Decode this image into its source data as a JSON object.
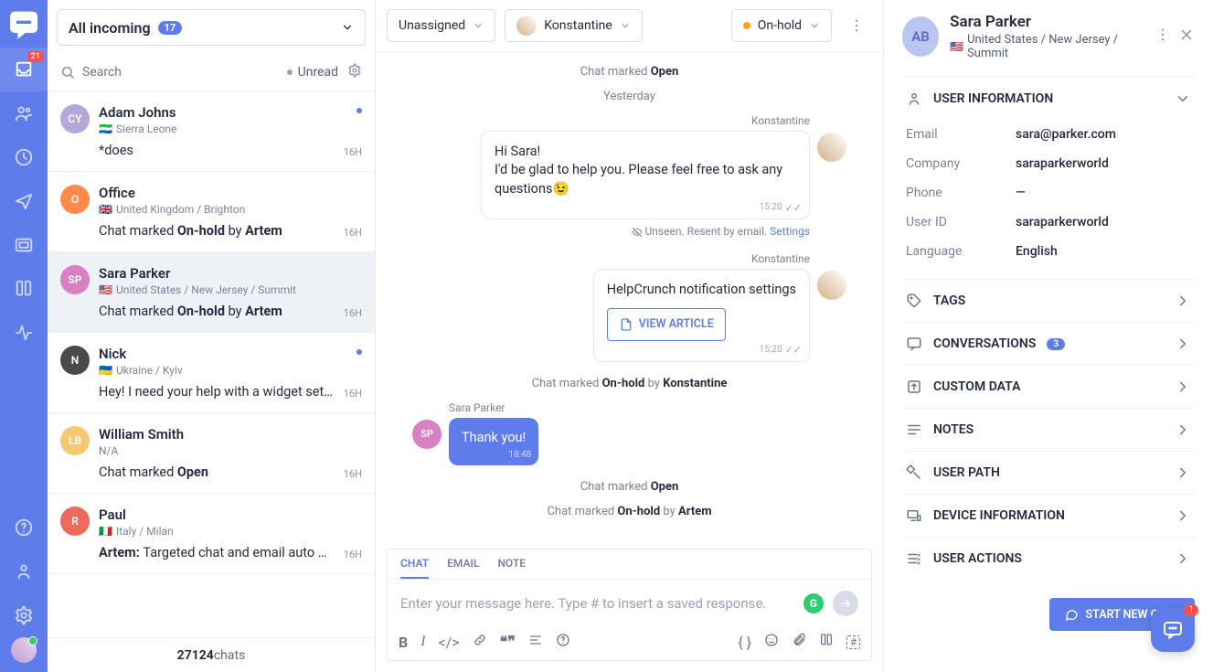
{
  "rail": {
    "inbox_badge": "21"
  },
  "filter": {
    "label": "All incoming",
    "count": "17"
  },
  "search": {
    "placeholder": "Search",
    "unread": "Unread"
  },
  "conversations": [
    {
      "initials": "CY",
      "name": "Adam Johns",
      "flag": "🇸🇱",
      "sub": "Sierra Leone",
      "msg": "*does",
      "time": "16H",
      "new": true,
      "avcls": "av-cy"
    },
    {
      "initials": "O",
      "name": "Office",
      "flag": "🇬🇧",
      "sub": "United Kingdom / Brighton",
      "msg_prefix": "Chat marked ",
      "msg_bold": "On-hold",
      "msg_by": " by ",
      "msg_who": "Artem",
      "time": "16H",
      "avcls": "av-o"
    },
    {
      "initials": "SP",
      "name": "Sara Parker",
      "flag": "🇺🇸",
      "sub": "United States / New Jersey / Summit",
      "msg_prefix": "Chat marked ",
      "msg_bold": "On-hold",
      "msg_by": " by ",
      "msg_who": "Artem",
      "time": "16H",
      "selected": true,
      "avcls": "av-sp"
    },
    {
      "initials": "N",
      "name": "Nick",
      "flag": "🇺🇦",
      "sub": "Ukraine / Kyiv",
      "msg": "Hey! I need your help with a widget set …",
      "time": "16H",
      "new": true,
      "avcls": "av-n"
    },
    {
      "initials": "LB",
      "name": "William Smith",
      "sub": "N/A",
      "msg_prefix": "Chat marked ",
      "msg_bold": "Open",
      "time": "16H",
      "avcls": "av-lb"
    },
    {
      "initials": "R",
      "name": "Paul",
      "flag": "🇮🇹",
      "sub": "Italy / Milan",
      "msg_who2": "Artem: ",
      "msg": "Targeted chat and email auto …",
      "time": "16H",
      "avcls": "av-r"
    }
  ],
  "footer": {
    "count": "27124",
    "label": " chats"
  },
  "header": {
    "assign": "Unassigned",
    "agent": "Konstantine",
    "status": "On-hold"
  },
  "chat": {
    "sys_open_prefix": "Chat marked ",
    "sys_open_bold": "Open",
    "day": "Yesterday",
    "m1_sender": "Konstantine",
    "m1_text": "Hi Sara!\nI'd be glad to help you. Please feel free to ask any questions😉",
    "m1_time": "15:20",
    "unseen": "Unseen. Resent by email. ",
    "unseen_link": "Settings",
    "m2_sender": "Konstantine",
    "m2_text": "HelpCrunch notification settings",
    "m2_btn": "VIEW ARTICLE",
    "m2_time": "15:20",
    "sys_hold_prefix": "Chat marked ",
    "sys_hold_bold": "On-hold",
    "sys_hold_by": " by ",
    "sys_hold_who": "Konstantine",
    "m3_sender": "Sara Parker",
    "m3_text": "Thank you!",
    "m3_time": "18:48",
    "sys_open2_prefix": "Chat marked ",
    "sys_open2_bold": "Open",
    "sys_hold2_prefix": "Chat marked ",
    "sys_hold2_bold": "On-hold",
    "sys_hold2_by": " by ",
    "sys_hold2_who": "Artem"
  },
  "composer": {
    "tabs": [
      "CHAT",
      "EMAIL",
      "NOTE"
    ],
    "placeholder": "Enter your message here. Type # to insert a saved response."
  },
  "user": {
    "initials": "AB",
    "name": "Sara Parker",
    "flag": "🇺🇸",
    "loc": "United States / New Jersey / Summit",
    "section_info": "USER INFORMATION",
    "email_k": "Email",
    "email_v": "sara@parker.com",
    "company_k": "Company",
    "company_v": "saraparkerworld",
    "phone_k": "Phone",
    "phone_v": "—",
    "uid_k": "User ID",
    "uid_v": "saraparkerworld",
    "lang_k": "Language",
    "lang_v": "English"
  },
  "sections": {
    "tags": "TAGS",
    "conversations": "CONVERSATIONS",
    "conv_count": "3",
    "custom": "CUSTOM DATA",
    "notes": "NOTES",
    "path": "USER PATH",
    "device": "DEVICE INFORMATION",
    "actions": "USER ACTIONS"
  },
  "start_btn": "START NEW CHAT",
  "fab_badge": "1"
}
